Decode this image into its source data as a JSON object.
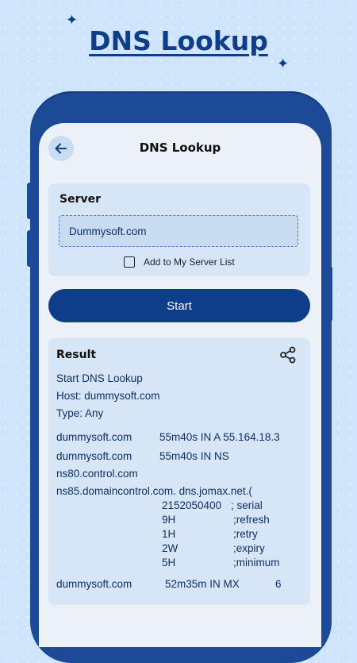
{
  "headline": "DNS Lookup",
  "app_bar": {
    "back_icon": "arrow-left-icon",
    "title": "DNS Lookup"
  },
  "server_card": {
    "title": "Server",
    "input_value": "Dummysoft.com",
    "checkbox_label": "Add to My Server List",
    "checkbox_checked": false
  },
  "start_button": "Start",
  "result_card": {
    "title": "Result",
    "share_icon": "share-icon",
    "header_lines": [
      "Start DNS Lookup",
      "Host: dummysoft.com",
      "Type: Any"
    ],
    "records": [
      {
        "host": "dummysoft.com",
        "value": "55m40s IN A 55.164.18.3"
      },
      {
        "host": "dummysoft.com",
        "value": "55m40s IN NS"
      }
    ],
    "ns_line": "ns80.control.com",
    "soa_line": "ns85.domaincontrol.com. dns.jomax.net.(",
    "soa_rows": [
      {
        "value": "2152050400",
        "label": "; serial"
      },
      {
        "value": "9H",
        "label": ";refresh"
      },
      {
        "value": "1H",
        "label": ";retry"
      },
      {
        "value": "2W",
        "label": ";expiry"
      },
      {
        "value": "5H",
        "label": ";minimum"
      }
    ],
    "mx_record": {
      "host": "dummysoft.com",
      "value": "52m35m IN MX",
      "priority": "6"
    }
  },
  "colors": {
    "accent": "#0e3d8a",
    "background": "#cfe5fb",
    "card": "#d6e6f7",
    "phone_frame": "#1d4a97"
  }
}
